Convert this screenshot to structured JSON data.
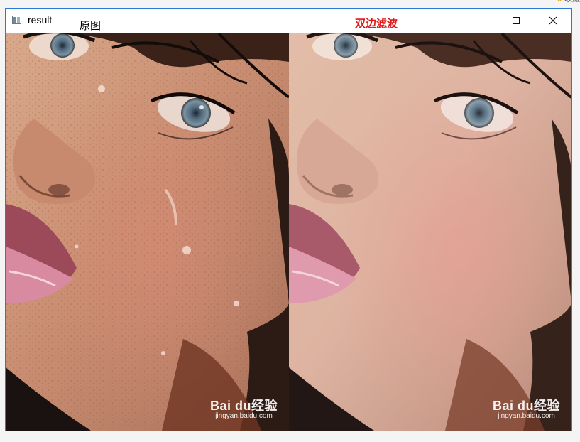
{
  "corner": {
    "label": "收藏"
  },
  "window": {
    "title": "result",
    "label_original": "原图",
    "label_filtered": "双边滤波",
    "controls": {
      "minimize": "minimize-icon",
      "maximize": "maximize-icon",
      "close": "close-icon"
    }
  },
  "watermark": {
    "brand": "Bai du经验",
    "url": "jingyan.baidu.com"
  },
  "colors": {
    "frame": "#2b79d6",
    "filtered_label": "#e01818"
  }
}
